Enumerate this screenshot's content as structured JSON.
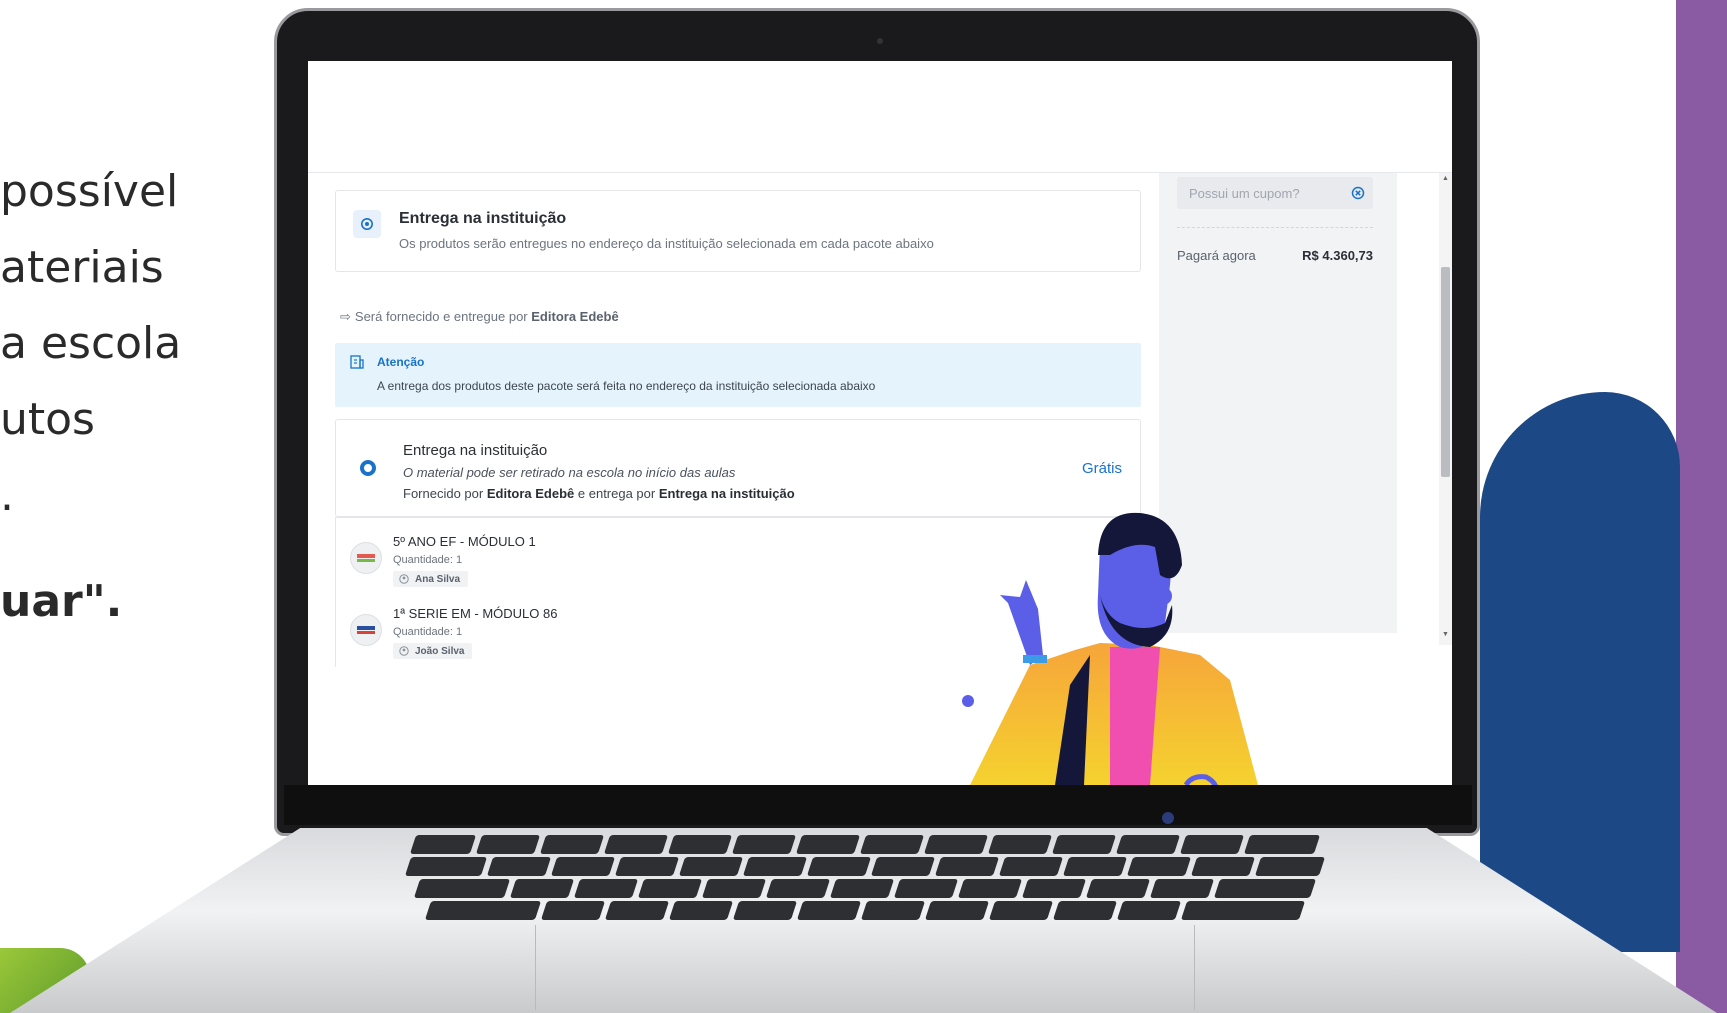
{
  "side_text": {
    "line1": "possível",
    "line2": "ateriais",
    "line3": "a escola",
    "line4": "utos",
    "line5": ".",
    "line6": "uar\"."
  },
  "delivery_header": {
    "title": "Entrega na instituição",
    "subtitle": "Os produtos serão entregues no endereço da instituição selecionada em cada pacote abaixo"
  },
  "supplier": {
    "prefix": "Será fornecido e entregue por",
    "name": "Editora Edebê"
  },
  "alert": {
    "title": "Atenção",
    "text": "A entrega dos produtos deste pacote será feita no endereço da instituição selecionada abaixo"
  },
  "delivery_option": {
    "title": "Entrega na instituição",
    "note": "O material pode ser retirado na escola no início das aulas",
    "line_prefix": "Fornecido por",
    "supplier": "Editora Edebê",
    "line_middle": "e entrega por",
    "method": "Entrega na instituição",
    "price": "Grátis"
  },
  "items": [
    {
      "name": "5º ANO EF - MÓDULO 1",
      "quantity": "Quantidade: 1",
      "student": "Ana Silva"
    },
    {
      "name": "1ª SERIE EM - MÓDULO 86",
      "quantity": "Quantidade: 1",
      "student": "João Silva"
    }
  ],
  "sidebar": {
    "coupon_placeholder": "Possui um cupom?",
    "pay_label": "Pagará agora",
    "pay_value": "R$ 4.360,73"
  },
  "colors": {
    "accent": "#1a73c8",
    "alert_bg": "#e4f3fc",
    "purple": "#8a5ba3",
    "navy": "#1c4886",
    "green": "#9bc83a"
  },
  "icons": [
    "location-pin-icon",
    "arrow-right-icon",
    "alert-building-icon",
    "radio-selected-icon",
    "user-circle-icon",
    "close-circle-icon"
  ]
}
